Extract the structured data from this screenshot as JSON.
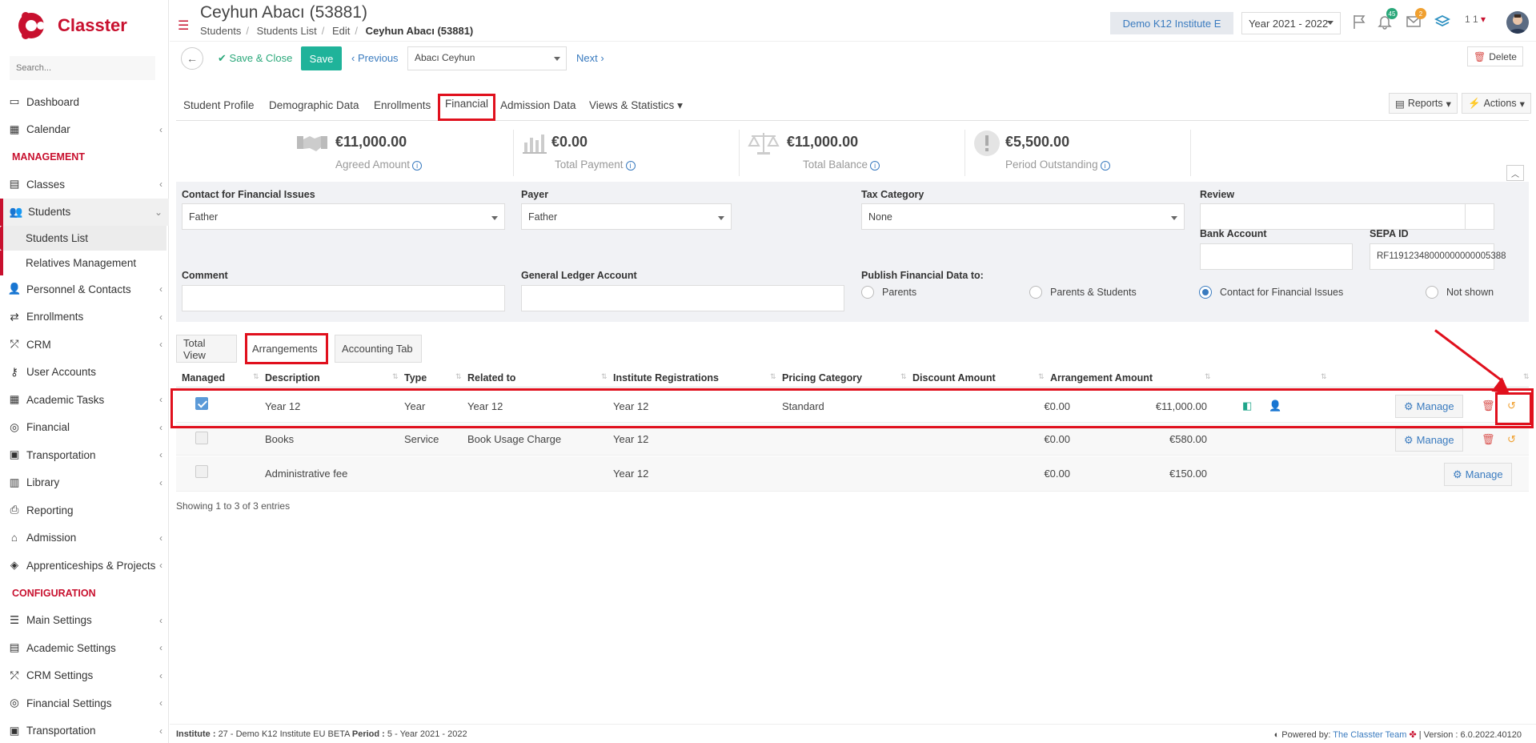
{
  "app": {
    "name": "Classter",
    "search_placeholder": "Search..."
  },
  "sidebar": {
    "items": [
      {
        "label": "Dashboard",
        "icon": "laptop-icon",
        "chevron": false
      },
      {
        "label": "Calendar",
        "icon": "calendar-icon",
        "chevron": true
      }
    ],
    "section_management": "MANAGEMENT",
    "management": [
      {
        "label": "Classes",
        "icon": "classes-icon",
        "chevron": true
      },
      {
        "label": "Students",
        "icon": "students-icon",
        "chevron": true
      }
    ],
    "students_sub": [
      "Students List",
      "Relatives Management"
    ],
    "management2": [
      {
        "label": "Personnel & Contacts",
        "icon": "user-icon",
        "chevron": true
      },
      {
        "label": "Enrollments",
        "icon": "exchange-icon",
        "chevron": true
      },
      {
        "label": "CRM",
        "icon": "crm-icon",
        "chevron": true
      },
      {
        "label": "User Accounts",
        "icon": "key-icon",
        "chevron": false
      },
      {
        "label": "Academic Tasks",
        "icon": "grid-icon",
        "chevron": true
      },
      {
        "label": "Financial",
        "icon": "coins-icon",
        "chevron": true
      },
      {
        "label": "Transportation",
        "icon": "bus-icon",
        "chevron": true
      },
      {
        "label": "Library",
        "icon": "library-icon",
        "chevron": true
      },
      {
        "label": "Reporting",
        "icon": "print-icon",
        "chevron": false
      },
      {
        "label": "Admission",
        "icon": "bank-icon",
        "chevron": true
      },
      {
        "label": "Apprenticeships & Projects",
        "icon": "cube-icon",
        "chevron": true
      }
    ],
    "section_configuration": "CONFIGURATION",
    "configuration": [
      {
        "label": "Main Settings",
        "icon": "sliders-icon",
        "chevron": true
      },
      {
        "label": "Academic Settings",
        "icon": "classes-icon",
        "chevron": true
      },
      {
        "label": "CRM Settings",
        "icon": "crm-icon",
        "chevron": true
      },
      {
        "label": "Financial Settings",
        "icon": "coins-icon",
        "chevron": true
      },
      {
        "label": "Transportation",
        "icon": "bus-icon",
        "chevron": true
      }
    ]
  },
  "header": {
    "title": "Ceyhun Abacı (53881)",
    "breadcrumb": [
      "Students",
      "Students List",
      "Edit",
      "Ceyhun Abacı (53881)"
    ],
    "institute": "Demo K12 Institute E",
    "year": "Year 2021 - 2022",
    "notifications_count": "45",
    "messages_count": "2",
    "user_short": "1 1"
  },
  "toolbar": {
    "save_close": "Save & Close",
    "save": "Save",
    "previous": "Previous",
    "student": "Abacı Ceyhun",
    "next": "Next",
    "delete": "Delete"
  },
  "tabs": [
    "Student Profile",
    "Demographic Data",
    "Enrollments",
    "Financial",
    "Admission Data",
    "Views & Statistics"
  ],
  "tab_buttons": {
    "reports": "Reports",
    "actions": "Actions"
  },
  "summary": [
    {
      "value": "€11,000.00",
      "label": "Agreed Amount"
    },
    {
      "value": "€0.00",
      "label": "Total Payment"
    },
    {
      "value": "€11,000.00",
      "label": "Total Balance"
    },
    {
      "value": "€5,500.00",
      "label": "Period Outstanding"
    }
  ],
  "form": {
    "contact_label": "Contact for Financial Issues",
    "contact_value": "Father",
    "payer_label": "Payer",
    "payer_value": "Father",
    "tax_label": "Tax Category",
    "tax_value": "None",
    "review_label": "Review",
    "bank_label": "Bank Account",
    "sepa_label": "SEPA ID",
    "sepa_value": "RF11912348000000000005388",
    "comment_label": "Comment",
    "gl_label": "General Ledger Account",
    "publish_label": "Publish Financial Data to:",
    "publish_options": [
      "Parents",
      "Parents & Students",
      "Contact for Financial Issues",
      "Not shown"
    ],
    "publish_selected": "Contact for Financial Issues"
  },
  "subtabs": [
    "Total View",
    "Arrangements",
    "Accounting Tab"
  ],
  "table": {
    "headers": [
      "Managed",
      "Description",
      "Type",
      "Related to",
      "Institute Registrations",
      "Pricing Category",
      "Discount Amount",
      "Arrangement Amount"
    ],
    "rows": [
      {
        "managed": true,
        "description": "Year 12",
        "type": "Year",
        "related": "Year 12",
        "registrations": "Year 12",
        "pricing": "Standard",
        "discount": "€0.00",
        "amount": "€11,000.00",
        "manage": "Manage"
      },
      {
        "managed": false,
        "description": "Books",
        "type": "Service",
        "related": "Book Usage Charge",
        "registrations": "Year 12",
        "pricing": "",
        "discount": "€0.00",
        "amount": "€580.00",
        "manage": "Manage"
      },
      {
        "managed": false,
        "description": "Administrative fee",
        "type": "",
        "related": "",
        "registrations": "Year 12",
        "pricing": "",
        "discount": "€0.00",
        "amount": "€150.00",
        "manage": "Manage"
      }
    ],
    "showing": "Showing 1 to 3 of 3 entries"
  },
  "footer": {
    "institute_label": "Institute :",
    "institute_value": "27 - Demo K12 Institute EU BETA",
    "period_label": "Period :",
    "period_value": "5 - Year 2021 - 2022",
    "powered": "Powered by:",
    "team": "The Classter Team",
    "version": "| Version : 6.0.2022.40120"
  },
  "colors": {
    "brand": "#c8102e",
    "accent": "#3a7bbf",
    "save": "#1fb39a",
    "highlight": "#e0101d"
  }
}
